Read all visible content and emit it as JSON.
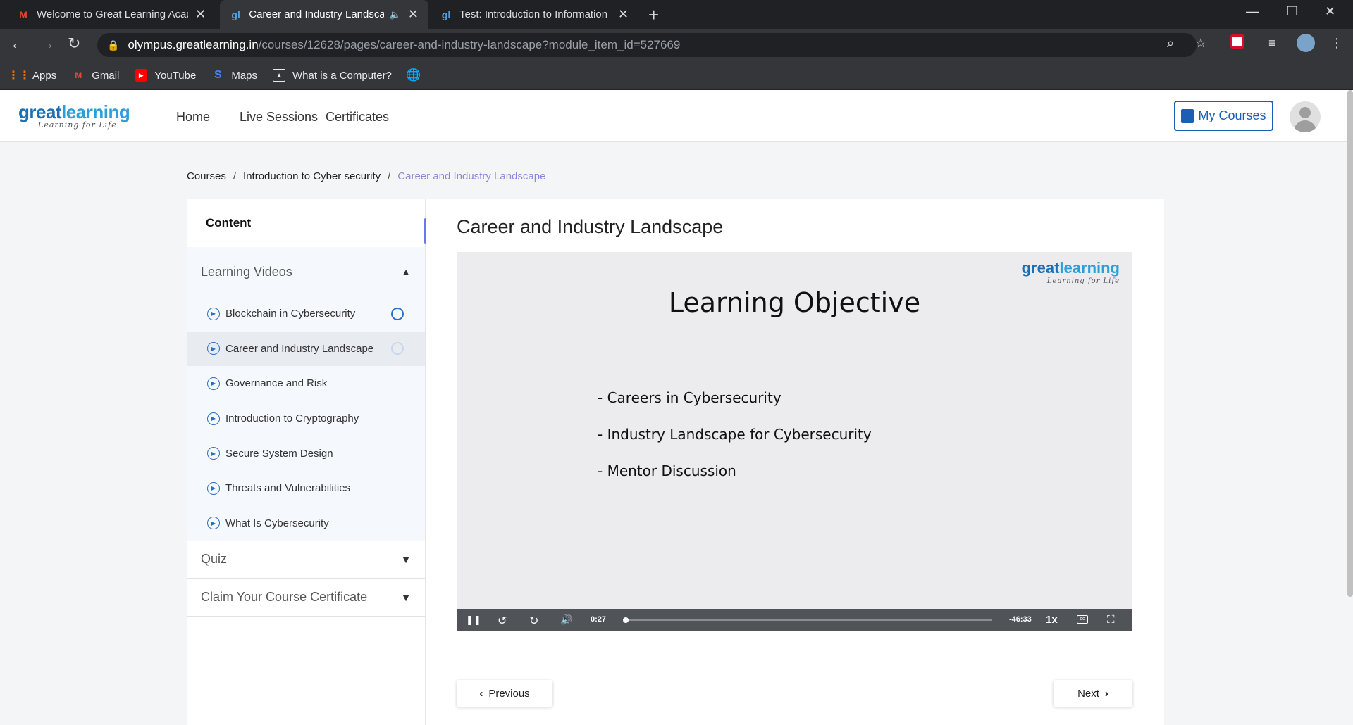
{
  "browser": {
    "tabs": [
      {
        "title": "Welcome to Great Learning Acad",
        "icon": "gmail-icon"
      },
      {
        "title": "Career and Industry Landscape",
        "icon": "greatlearning-icon",
        "active": true
      },
      {
        "title": "Test: Introduction to Information",
        "icon": "greatlearning-icon"
      }
    ],
    "url_host": "olympus.greatlearning.in",
    "url_path": "/courses/12628/pages/career-and-industry-landscape?module_item_id=527669",
    "bookmarks": [
      {
        "label": "Apps",
        "icon": "apps-grid-icon"
      },
      {
        "label": "Gmail",
        "icon": "gmail-icon"
      },
      {
        "label": "YouTube",
        "icon": "youtube-icon"
      },
      {
        "label": "Maps",
        "icon": "maps-icon"
      },
      {
        "label": "What is a Computer?",
        "icon": "page-icon"
      },
      {
        "label": "",
        "icon": "globe-icon"
      }
    ]
  },
  "header": {
    "logo_main": "great",
    "logo_accent": "learning",
    "logo_tagline": "Learning for Life",
    "nav": [
      "Home",
      "Live Sessions",
      "Certificates"
    ],
    "my_courses": "My Courses"
  },
  "breadcrumb": {
    "items": [
      "Courses",
      "Introduction to Cyber security",
      "Career and Industry Landscape"
    ],
    "separator": "/"
  },
  "sidebar": {
    "heading": "Content",
    "section_videos": "Learning Videos",
    "lessons": [
      "Blockchain in Cybersecurity",
      "Career and Industry Landscape",
      "Governance and Risk",
      "Introduction to Cryptography",
      "Secure System Design",
      "Threats and Vulnerabilities",
      "What Is Cybersecurity"
    ],
    "section_quiz": "Quiz",
    "section_certificate": "Claim Your Course Certificate"
  },
  "main": {
    "title": "Career and Industry Landscape",
    "slide_title": "Learning Objective",
    "bullets": [
      "- Careers in Cybersecurity",
      "- Industry Landscape for Cybersecurity",
      "- Mentor Discussion"
    ],
    "video_logo_main": "great",
    "video_logo_accent": "learning",
    "video_logo_tagline": "Learning for Life",
    "time_elapsed": "0:27",
    "time_remaining": "-46:33",
    "speed": "1x",
    "previous": "Previous",
    "next": "Next"
  }
}
